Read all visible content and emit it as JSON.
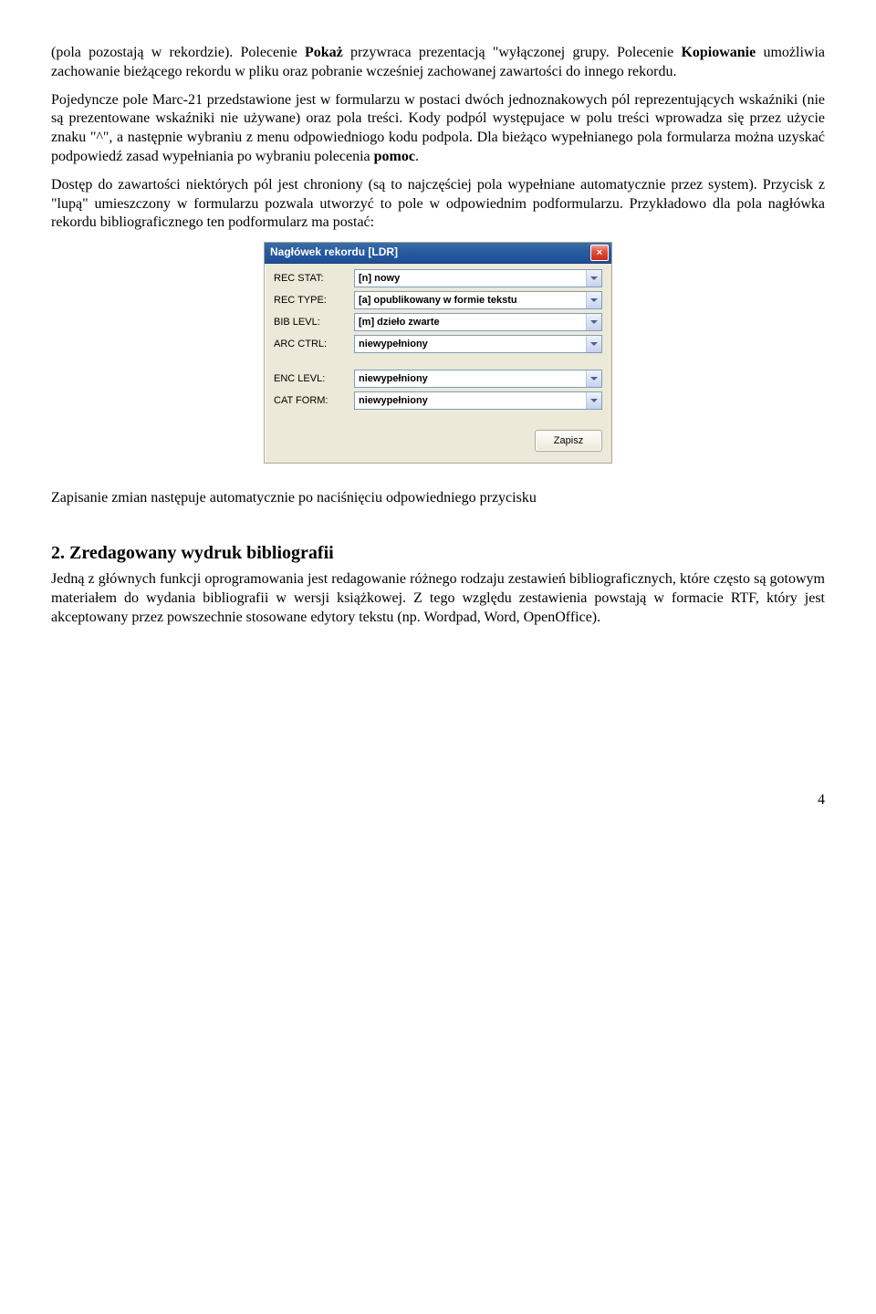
{
  "paragraphs": {
    "p1a": "(pola pozostają w rekordzie). Polecenie ",
    "p1b": "Pokaż",
    "p1c": " przywraca prezentacją \"wyłączonej grupy. Polecenie ",
    "p1d": "Kopiowanie",
    "p1e": " umożliwia zachowanie bieżącego rekordu w pliku oraz pobranie wcześniej zachowanej zawartości do innego rekordu.",
    "p2a": "Pojedyncze pole Marc-21 przedstawione jest w formularzu w postaci dwóch jednoznakowych pól reprezentujących wskaźniki (nie są prezentowane wskaźniki nie używane) oraz pola treści. Kody podpól występujace w polu treści wprowadza się przez użycie znaku \"^\", a następnie wybraniu z menu odpowiedniogo kodu podpola. Dla bieżąco wypełnianego pola formularza można uzyskać podpowiedź zasad wypełniania po wybraniu polecenia ",
    "p2b": "pomoc",
    "p2c": ".",
    "p3": "Dostęp do zawartości niektórych pól jest chroniony (są to najczęściej pola wypełniane automatycznie przez system). Przycisk z \"lupą\" umieszczony w formularzu pozwala utworzyć to pole w odpowiednim podformularzu. Przykładowo dla pola nagłówka rekordu bibliograficznego ten podformularz ma postać:",
    "p4": "Zapisanie zmian następuje automatycznie po naciśnięciu odpowiedniego przycisku",
    "h2": "2. Zredagowany wydruk bibliografii",
    "p5": "Jedną z głównych funkcji oprogramowania jest redagowanie różnego rodzaju zestawień bibliograficznych, które często są gotowym materiałem do wydania bibliografii w wersji książkowej. Z tego względu zestawienia powstają w formacie RTF, który jest akceptowany przez powszechnie stosowane edytory tekstu (np. Wordpad, Word, OpenOffice)."
  },
  "dialog": {
    "title": "Nagłówek rekordu [LDR]",
    "rows1": [
      {
        "label": "REC STAT:",
        "value": "[n] nowy"
      },
      {
        "label": "REC TYPE:",
        "value": "[a] opublikowany w formie tekstu"
      },
      {
        "label": "BIB LEVL:",
        "value": "[m] dzieło zwarte"
      },
      {
        "label": "ARC CTRL:",
        "value": "niewypełniony"
      }
    ],
    "rows2": [
      {
        "label": "ENC LEVL:",
        "value": "niewypełniony"
      },
      {
        "label": "CAT FORM:",
        "value": "niewypełniony"
      }
    ],
    "save": "Zapisz"
  },
  "page_number": "4"
}
